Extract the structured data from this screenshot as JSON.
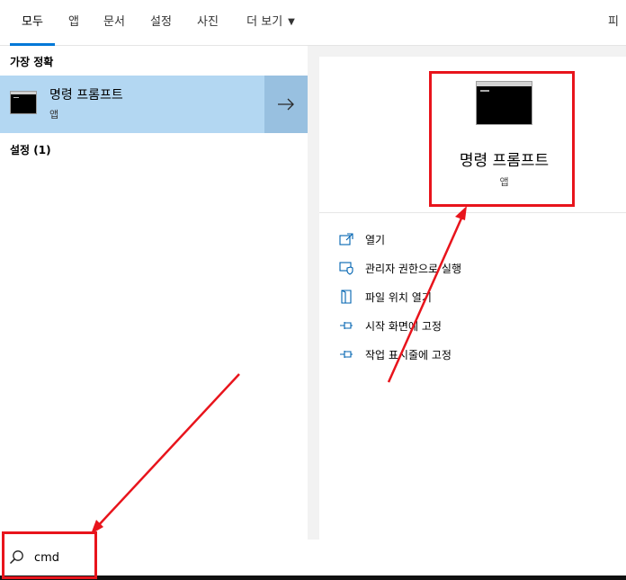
{
  "tabs": [
    {
      "label": "모두",
      "active": true
    },
    {
      "label": "앱"
    },
    {
      "label": "문서"
    },
    {
      "label": "설정"
    },
    {
      "label": "사진"
    },
    {
      "label": "더 보기"
    }
  ],
  "tab_right_label": "피드백",
  "left": {
    "best_match_title": "가장 정확",
    "best_match": {
      "name": "명령 프롬프트",
      "kind": "앱"
    },
    "settings_title": "설정 (1)"
  },
  "detail": {
    "name": "명령 프롬프트",
    "kind": "앱",
    "actions": [
      {
        "label": "열기",
        "icon": "open-icon"
      },
      {
        "label": "관리자 권한으로 실행",
        "icon": "shield-icon"
      },
      {
        "label": "파일 위치 열기",
        "icon": "file-location-icon"
      },
      {
        "label": "시작 화면에 고정",
        "icon": "pin-icon"
      },
      {
        "label": "작업 표시줄에 고정",
        "icon": "pin-icon"
      }
    ]
  },
  "search": {
    "value": "cmd"
  },
  "colors": {
    "accent": "#0078d7",
    "selection": "#b3d7f2",
    "annotation": "#e8141c"
  }
}
